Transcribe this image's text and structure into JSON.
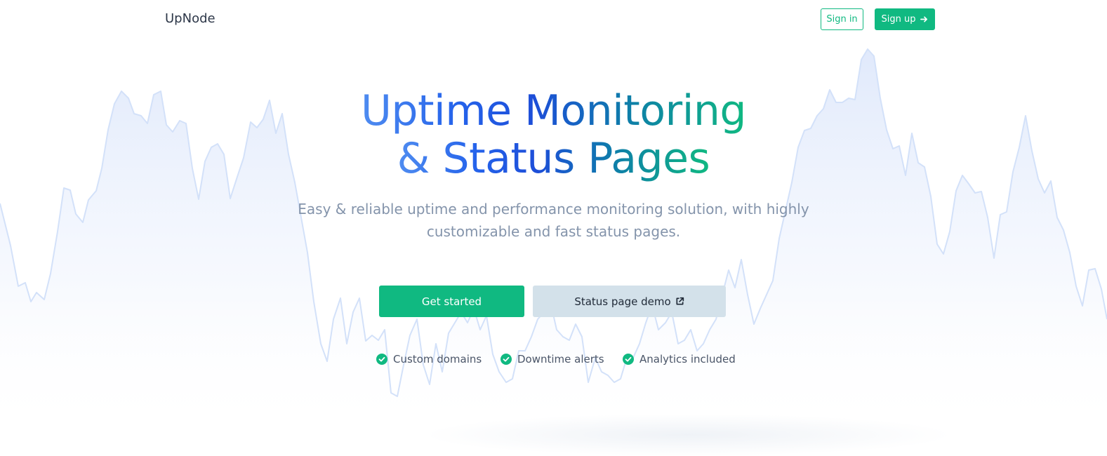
{
  "header": {
    "brand": "UpNode",
    "sign_in_label": "Sign in",
    "sign_up_label": "Sign up"
  },
  "hero": {
    "title_line1": "Uptime Monitoring",
    "title_line2": "& Status Pages",
    "subtitle_line1": "Easy & reliable uptime and performance monitoring solution, with highly",
    "subtitle_line2": "customizable and fast status pages.",
    "primary_cta": "Get started",
    "secondary_cta": "Status page demo"
  },
  "features": [
    {
      "label": "Custom domains",
      "icon": "check-circle-icon"
    },
    {
      "label": "Downtime alerts",
      "icon": "check-circle-icon"
    },
    {
      "label": "Analytics included",
      "icon": "check-circle-icon"
    }
  ],
  "colors": {
    "accent": "#10b981",
    "secondary_button": "#d3e1ea",
    "subtitle": "#8494ab",
    "chart_line": "#d3e1f9",
    "gradient_start": "#4f8cf0",
    "gradient_mid": "#1d4ed8",
    "gradient_end": "#10b981"
  }
}
